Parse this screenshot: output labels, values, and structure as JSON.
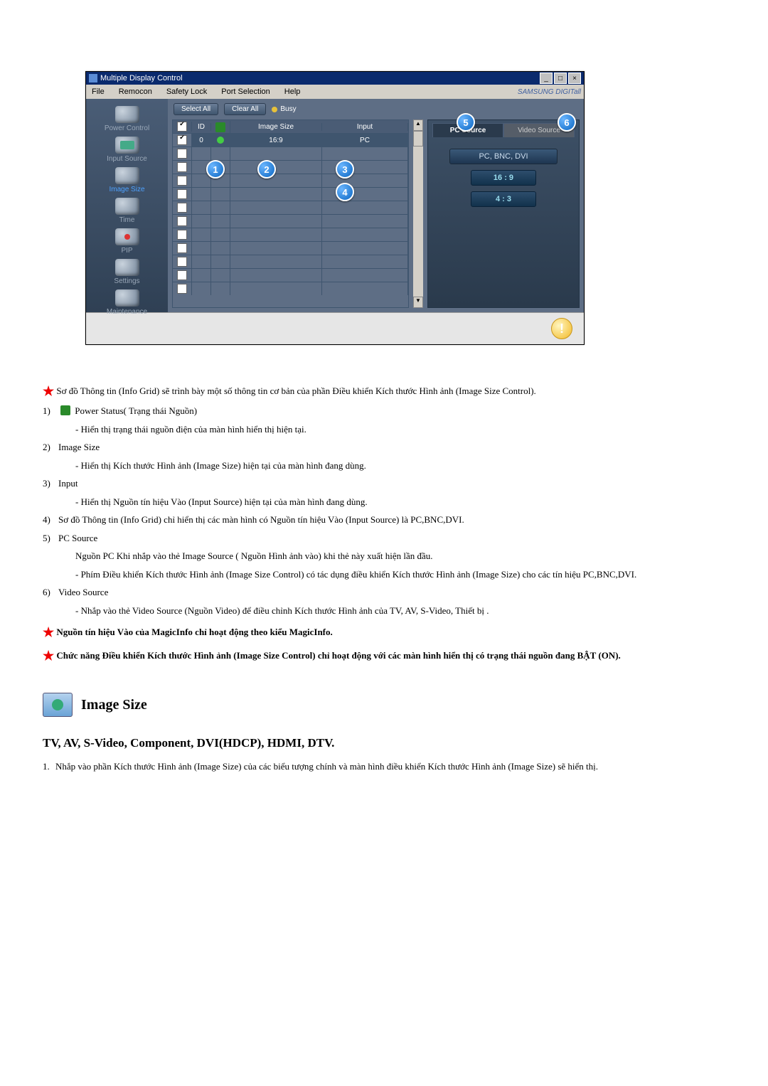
{
  "window": {
    "title": "Multiple Display Control",
    "menu": {
      "file": "File",
      "remocon": "Remocon",
      "safety": "Safety Lock",
      "port": "Port Selection",
      "help": "Help"
    },
    "brand": "SAMSUNG DIGITall"
  },
  "sidebar": {
    "power": "Power Control",
    "input": "Input Source",
    "image": "Image Size",
    "time": "Time",
    "pip": "PIP",
    "settings": "Settings",
    "maint": "Maintenance"
  },
  "toolbar": {
    "select_all": "Select All",
    "clear_all": "Clear All",
    "busy": "Busy"
  },
  "grid": {
    "h_chk": "✔",
    "h_id": "ID",
    "h_pw": " ",
    "h_size": "Image Size",
    "h_input": "Input",
    "row1": {
      "id": "0",
      "size": "16:9",
      "input": "PC"
    }
  },
  "right": {
    "tab_pc": "PC Source",
    "tab_video": "Video Source",
    "mode": "PC, BNC, DVI",
    "btn1": "16 : 9",
    "btn2": "4 : 3"
  },
  "callouts": {
    "c1": "1",
    "c2": "2",
    "c3": "3",
    "c4": "4",
    "c5": "5",
    "c6": "6"
  },
  "doc": {
    "star1": "Sơ đồ Thông tin (Info Grid) sẽ trình bày một số thông tin cơ bản của phần Điều khiển Kích thước Hình ảnh (Image Size Control).",
    "i1_n": "1)",
    "i1_t": " Power Status( Trạng thái Nguồn)",
    "i1_s": "- Hiển thị trạng thái nguồn điện của màn hình hiển thị hiện tại.",
    "i2_n": "2)",
    "i2_t": "Image Size",
    "i2_s": "- Hiển thị Kích thước Hình ảnh (Image Size) hiện tại của màn hình đang dùng.",
    "i3_n": "3)",
    "i3_t": "Input",
    "i3_s": "- Hiển thị Nguồn tín hiệu Vào (Input Source) hiện tại của màn hình đang dùng.",
    "i4_n": "4)",
    "i4_t": "Sơ đồ Thông tin (Info Grid) chỉ hiển thị các màn hình có Nguồn tín hiệu Vào (Input Source) là PC,BNC,DVI.",
    "i5_n": "5)",
    "i5_t": "PC Source",
    "i5_s1": "Nguồn PC Khi nhắp vào thẻ Image Source ( Nguồn Hình ảnh vào) khi thẻ này xuất hiện lần đầu.",
    "i5_s2": "- Phím Điều khiển Kích thước Hình ảnh (Image Size Control) có tác dụng điều khiển Kích thước Hình ảnh (Image Size) cho các tín hiệu PC,BNC,DVI.",
    "i6_n": "6)",
    "i6_t": "Video Source",
    "i6_s": "- Nhắp vào thẻ Video Source (Nguồn Video) để điều chỉnh Kích thước Hình ảnh của TV, AV, S-Video, Thiết bị .",
    "star2": "Nguồn tín hiệu Vào của MagicInfo chỉ hoạt động theo kiểu MagicInfo.",
    "star3": "Chức năng Điều khiển Kích thước Hình ảnh (Image Size Control) chỉ hoạt động với các màn hình hiển thị có trạng thái nguồn đang BẬT (ON).",
    "section_title": "Image Size",
    "subheading": "TV, AV, S-Video, Component, DVI(HDCP), HDMI, DTV.",
    "ol1_n": "1.",
    "ol1_t": "Nhắp vào phần Kích thước Hình ảnh (Image Size) của các biểu tượng chính và màn hình điều khiển Kích thước Hình ảnh (Image Size) sẽ hiển thị."
  }
}
